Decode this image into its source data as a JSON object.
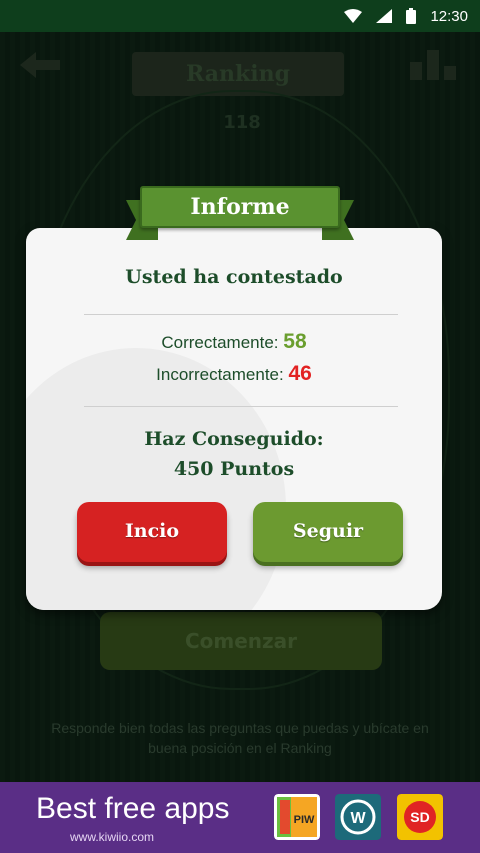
{
  "status_bar": {
    "time": "12:30",
    "icons": [
      "wifi-icon",
      "signal-icon",
      "battery-icon"
    ]
  },
  "background_screen": {
    "title": "Ranking",
    "number": "118",
    "cta_label": "Comenzar",
    "help_text": "Responde bien todas las preguntas que puedas y ubícate en buena posición en el Ranking"
  },
  "dialog": {
    "title": "Informe",
    "heading": "Usted ha contestado",
    "correct_label": "Correctamente:",
    "correct_value": "58",
    "incorrect_label": "Incorrectamente:",
    "incorrect_value": "46",
    "achieved_label": "Haz Conseguido:",
    "points": "450 Puntos",
    "buttons": {
      "start": "Incio",
      "continue": "Seguir"
    }
  },
  "ad_banner": {
    "title": "Best free apps",
    "url": "www.kiwiio.com",
    "apps": [
      {
        "label": "PIW",
        "color": "#f5a623"
      },
      {
        "label": "W",
        "color": "#2a8fa0"
      },
      {
        "label": "SD",
        "color": "#f2c200"
      }
    ]
  },
  "colors": {
    "accent_green": "#5a9230",
    "danger_red": "#d62222",
    "text_dark_green": "#1d4d2a"
  }
}
